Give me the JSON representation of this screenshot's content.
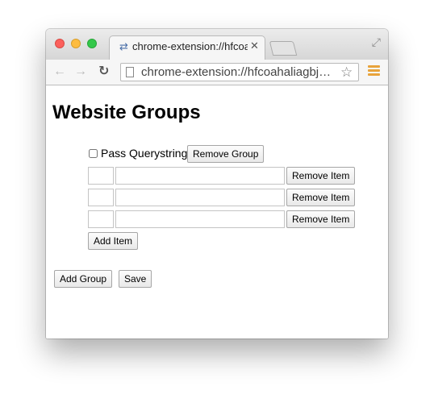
{
  "browser": {
    "tab_title": "chrome-extension://hfcoahaliag",
    "tab_icon": "⇄",
    "tab_close": "✕",
    "url": "chrome-extension://hfcoahaliagbjeiiemjbgjbgcphhdmbe/options.html"
  },
  "page": {
    "title": "Website Groups",
    "group": {
      "pass_querystring_label": "Pass Querystring",
      "remove_group_label": "Remove Group",
      "items": [
        {
          "key": "",
          "value": "",
          "remove_label": "Remove Item"
        },
        {
          "key": "",
          "value": "",
          "remove_label": "Remove Item"
        },
        {
          "key": "",
          "value": "",
          "remove_label": "Remove Item"
        }
      ],
      "add_item_label": "Add Item"
    },
    "add_group_label": "Add Group",
    "save_label": "Save"
  },
  "colors": {
    "close_light": "#fc605c",
    "minimize_light": "#fdbc40",
    "maximize_light": "#34c84a",
    "menu_accent": "#e8a33b"
  }
}
